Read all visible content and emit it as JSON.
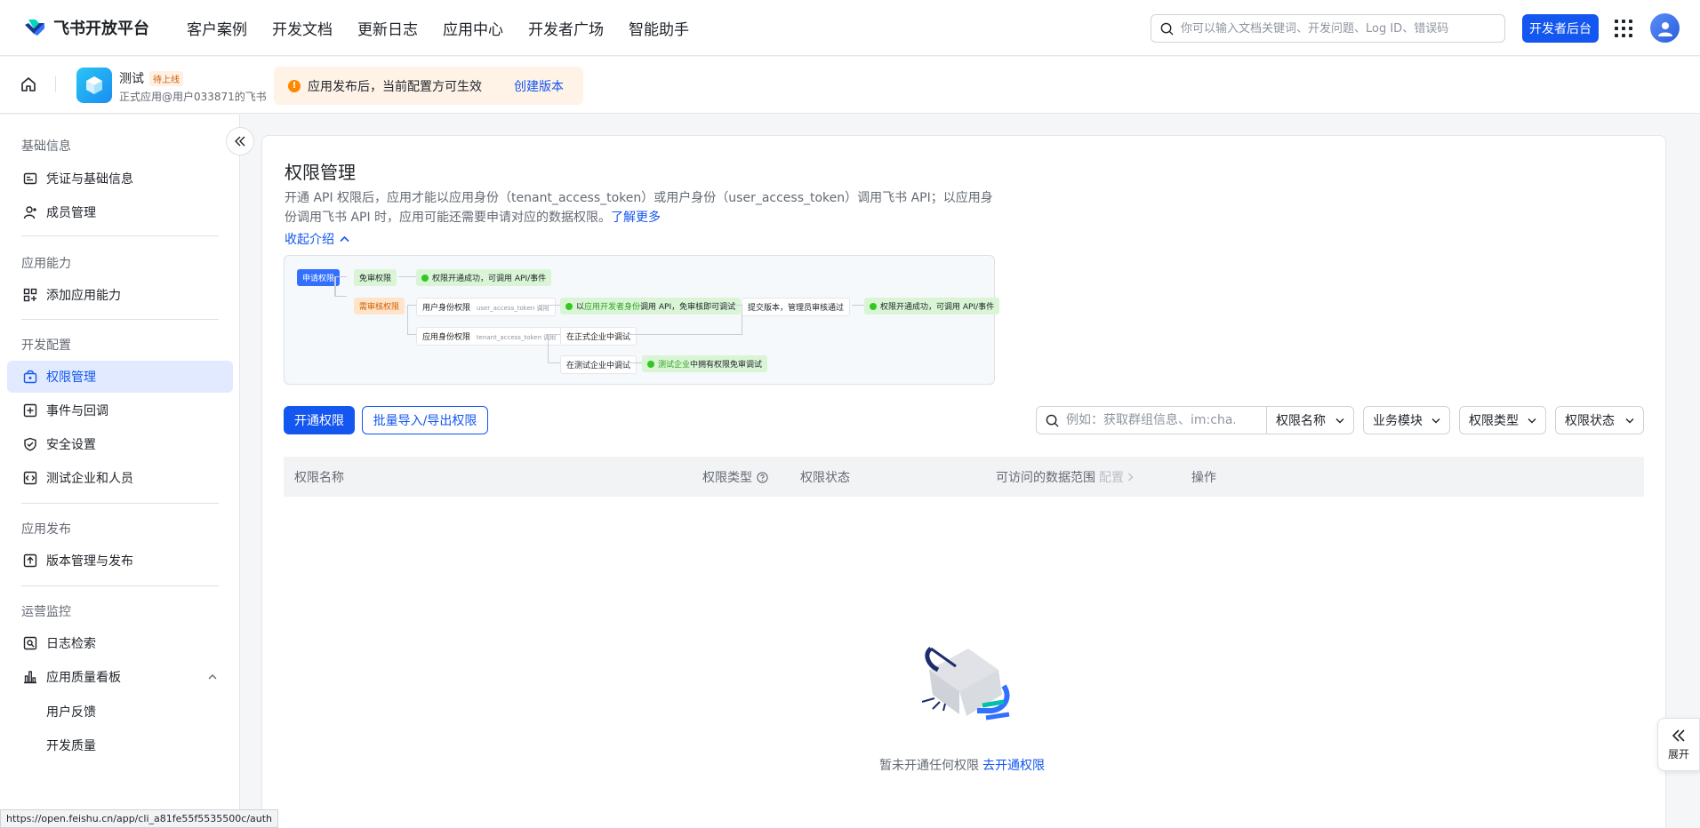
{
  "topnav": {
    "brand": "飞书开放平台",
    "links": [
      "客户案例",
      "开发文档",
      "更新日志",
      "应用中心",
      "开发者广场",
      "智能助手"
    ],
    "search_placeholder": "你可以输入文档关键词、开发问题、Log ID、错误码",
    "dev_console": "开发者后台"
  },
  "appbar": {
    "app_name": "测试",
    "app_status": "待上线",
    "app_sub": "正式应用@用户033871的飞书",
    "notice_icon": "!",
    "notice_text": "应用发布后，当前配置方可生效",
    "notice_link": "创建版本"
  },
  "sidebar": {
    "sections": [
      "基础信息",
      "应用能力",
      "开发配置",
      "应用发布",
      "运营监控"
    ],
    "items": [
      {
        "label": "凭证与基础信息",
        "icon": "credential-icon"
      },
      {
        "label": "成员管理",
        "icon": "member-icon"
      },
      {
        "label": "添加应用能力",
        "icon": "apps-add-icon"
      },
      {
        "label": "权限管理",
        "icon": "permission-icon"
      },
      {
        "label": "事件与回调",
        "icon": "event-icon"
      },
      {
        "label": "安全设置",
        "icon": "shield-icon"
      },
      {
        "label": "测试企业和人员",
        "icon": "code-icon"
      },
      {
        "label": "版本管理与发布",
        "icon": "upload-icon"
      },
      {
        "label": "日志检索",
        "icon": "log-search-icon"
      },
      {
        "label": "应用质量看板",
        "icon": "bar-chart-icon"
      }
    ],
    "subitems": [
      "用户反馈",
      "开发质量"
    ]
  },
  "main": {
    "title": "权限管理",
    "intro_text": "开通 API 权限后，应用才能以应用身份（tenant_access_token）或用户身份（user_access_token）调用飞书 API；以应用身份调用飞书 API 时，应用可能还需要申请对应的数据权限。",
    "learn_more": "了解更多",
    "collapse_intro": "收起介绍",
    "flow": {
      "apply": "申请权限",
      "free": "免审权限",
      "free_result": "权限开通成功，可调用 API/事件",
      "review": "需审核权限",
      "user_perm": "用户身份权限",
      "user_token": "user_access_token 调用",
      "dev_identity_prefix": "以",
      "dev_identity_highlight": "应用开发者身份",
      "dev_identity_suffix": "调用 API，免审核即可调试",
      "submit": "提交版本，管理员审核通过",
      "final_result": "权限开通成功，可调用 API/事件",
      "app_perm": "应用身份权限",
      "tenant_token": "tenant_access_token 调用",
      "formal_debug": "在正式企业中调试",
      "test_debug": "在测试企业中调试",
      "test_prefix": "测试企业",
      "test_suffix": "中拥有权限免审调试"
    },
    "btn_open": "开通权限",
    "btn_batch": "批量导入/导出权限",
    "filter_placeholder": "例如：获取群组信息、im:cha...",
    "filter_dropdowns": [
      "权限名称",
      "业务模块",
      "权限类型",
      "权限状态"
    ],
    "columns": [
      "权限名称",
      "权限类型",
      "权限状态",
      "可访问的数据范围",
      "配置",
      "操作"
    ],
    "empty_text": "暂未开通任何权限",
    "empty_link": "去开通权限"
  },
  "expand_label": "展开",
  "status_url": "https://open.feishu.cn/app/cli_a81fe55f5535500c/auth"
}
